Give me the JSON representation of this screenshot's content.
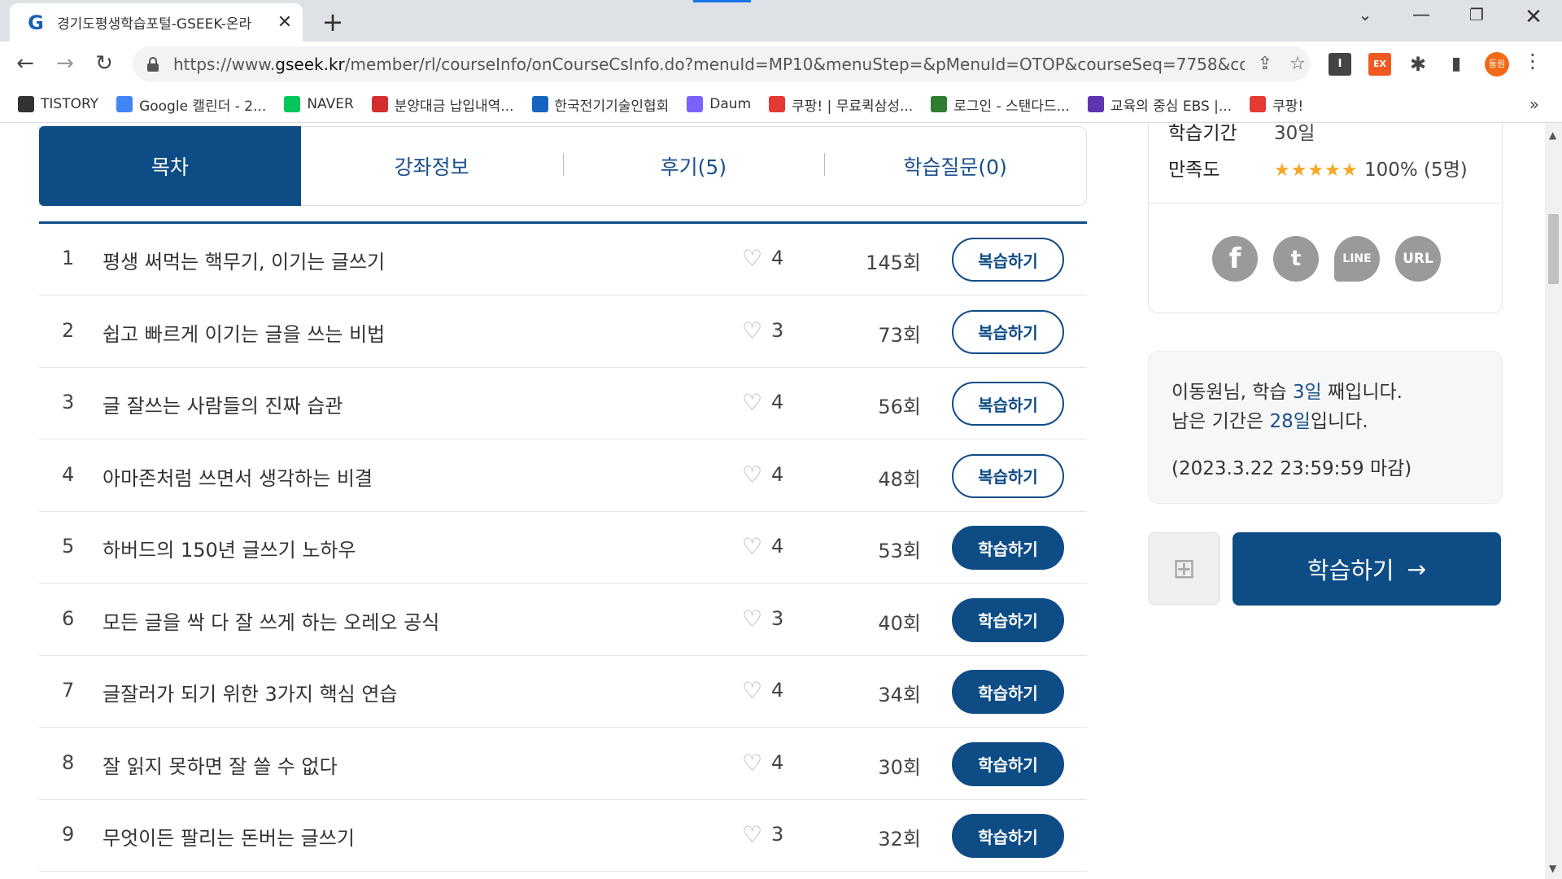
{
  "browser": {
    "tab_title": "경기도평생학습포털-GSEEK-온라",
    "url_prefix": "https://www.",
    "url_host": "gseek.kr",
    "url_path": "/member/rl/courseInfo/onCourseCsInfo.do?menuId=MP10&menuStep=&pMenuId=OTOP&courseSeq=7758&cou...",
    "profile_label": "동원",
    "bookmarks": [
      {
        "label": "TISTORY",
        "icon": "tistory-icon",
        "color": "#333333"
      },
      {
        "label": "Google 캘린더 - 2...",
        "icon": "calendar-icon",
        "color": "#4285f4"
      },
      {
        "label": "NAVER",
        "icon": "naver-icon",
        "color": "#03c75a"
      },
      {
        "label": "분양대금 납입내역...",
        "icon": "eg-icon",
        "color": "#d32f2f"
      },
      {
        "label": "한국전기기술인협회",
        "icon": "kea-icon",
        "color": "#1565c0"
      },
      {
        "label": "Daum",
        "icon": "daum-icon",
        "color": "#7b61ff"
      },
      {
        "label": "쿠팡! | 무료퀵삼성...",
        "icon": "coupang-icon",
        "color": "#e53935"
      },
      {
        "label": "로그인 - 스탠다드...",
        "icon": "sc-icon",
        "color": "#2e7d32"
      },
      {
        "label": "교육의 중심 EBS |...",
        "icon": "ebs-icon",
        "color": "#5e35b1"
      },
      {
        "label": "쿠팡!",
        "icon": "coupang-icon",
        "color": "#e53935"
      }
    ]
  },
  "tabs": [
    {
      "label": "목차",
      "active": true
    },
    {
      "label": "강좌정보",
      "active": false
    },
    {
      "label": "후기(5)",
      "active": false
    },
    {
      "label": "학습질문(0)",
      "active": false
    }
  ],
  "lessons": [
    {
      "num": "1",
      "title": "평생 써먹는 핵무기, 이기는 글쓰기",
      "likes": "4",
      "views": "145회",
      "action": "복습하기",
      "kind": "review"
    },
    {
      "num": "2",
      "title": "쉽고 빠르게 이기는 글을 쓰는 비법",
      "likes": "3",
      "views": "73회",
      "action": "복습하기",
      "kind": "review"
    },
    {
      "num": "3",
      "title": "글 잘쓰는 사람들의 진짜 습관",
      "likes": "4",
      "views": "56회",
      "action": "복습하기",
      "kind": "review"
    },
    {
      "num": "4",
      "title": "아마존처럼 쓰면서 생각하는 비결",
      "likes": "4",
      "views": "48회",
      "action": "복습하기",
      "kind": "review"
    },
    {
      "num": "5",
      "title": "하버드의 150년 글쓰기 노하우",
      "likes": "4",
      "views": "53회",
      "action": "학습하기",
      "kind": "study"
    },
    {
      "num": "6",
      "title": "모든 글을 싹 다 잘 쓰게 하는 오레오 공식",
      "likes": "3",
      "views": "40회",
      "action": "학습하기",
      "kind": "study"
    },
    {
      "num": "7",
      "title": "글잘러가 되기 위한 3가지 핵심 연습",
      "likes": "4",
      "views": "34회",
      "action": "학습하기",
      "kind": "study"
    },
    {
      "num": "8",
      "title": "잘 읽지 못하면 잘 쓸 수 없다",
      "likes": "4",
      "views": "30회",
      "action": "학습하기",
      "kind": "study"
    },
    {
      "num": "9",
      "title": "무엇이든 팔리는 돈버는 글쓰기",
      "likes": "3",
      "views": "32회",
      "action": "학습하기",
      "kind": "study"
    }
  ],
  "course_info": {
    "period_label": "학습기간",
    "period_value": "30일",
    "satisfaction_label": "만족도",
    "stars": "★★★★★",
    "satisfaction_value": "100% (5명)"
  },
  "share": {
    "fb": "f",
    "tw": "t",
    "line": "LINE",
    "url": "URL"
  },
  "status": {
    "line1_pre": "이동원님, 학습 ",
    "line1_hl": "3일",
    "line1_post": " 째입니다.",
    "line2_pre": "남은 기간은 ",
    "line2_hl": "28일",
    "line2_post": "입니다.",
    "deadline": "(2023.3.22 23:59:59 마감)"
  },
  "study_button": {
    "label": "학습하기",
    "arrow": "→"
  },
  "colors": {
    "primary": "#0e4c86",
    "star": "#f5a623"
  }
}
